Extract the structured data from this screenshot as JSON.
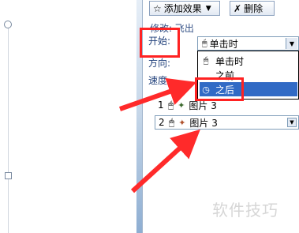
{
  "toolbar": {
    "add_effect_label": "添加效果",
    "delete_label": "删除"
  },
  "effect_line": "修改: 飞出",
  "form": {
    "start_label": "开始:",
    "direction_label": "方向:",
    "speed_label": "速度:"
  },
  "start_select": {
    "value": "单击时",
    "icon": "mouse-icon"
  },
  "dropdown": {
    "options": [
      {
        "label": "单击时",
        "icon": "mouse-icon"
      },
      {
        "label": "之前",
        "icon": "none"
      },
      {
        "label": "之后",
        "icon": "clock-icon",
        "selected": true
      }
    ]
  },
  "animation_list": [
    {
      "number": "1",
      "name": "图片 3",
      "icon": "star-icon"
    },
    {
      "number": "2",
      "name": "图片 3",
      "icon": "exit-star-icon"
    }
  ],
  "watermark": "软件技巧",
  "colors": {
    "highlight_box": "#ff2222",
    "selection": "#316ac5",
    "pane_text": "#1f3f7a"
  }
}
